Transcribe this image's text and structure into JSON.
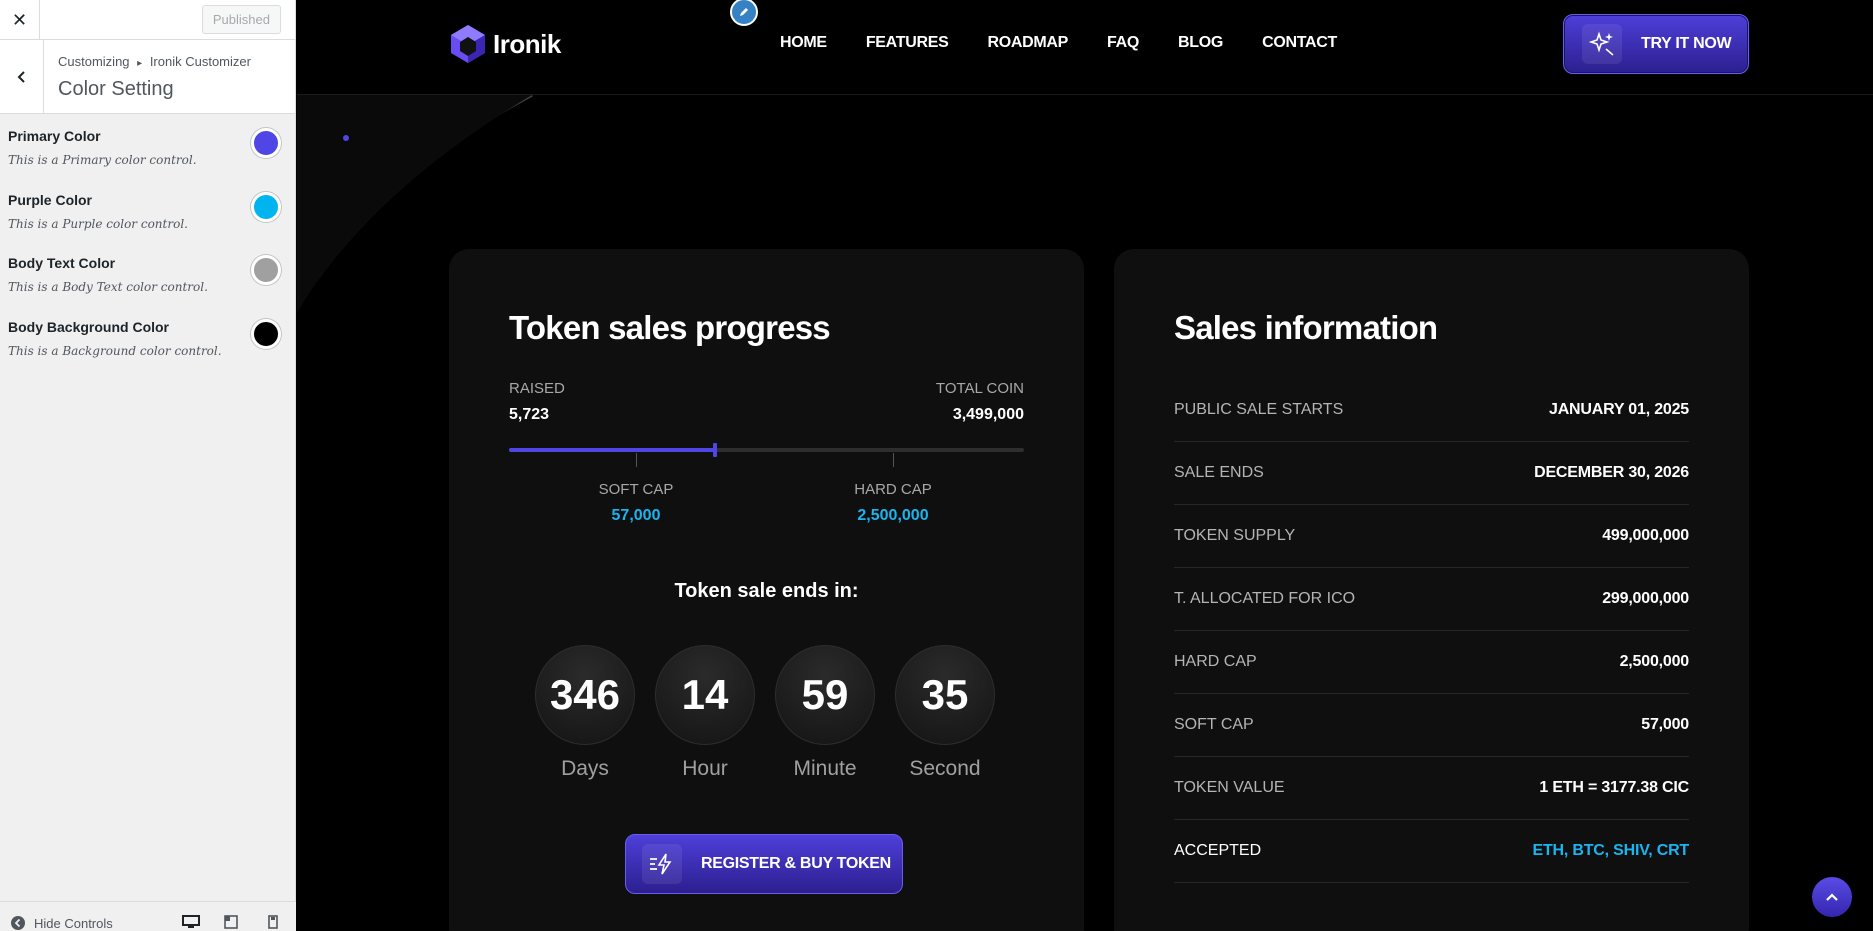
{
  "customizer": {
    "close_icon": "close-icon",
    "published_label": "Published",
    "breadcrumb_root": "Customizing",
    "breadcrumb_sep": "▸",
    "breadcrumb_parent": "Ironik Customizer",
    "section_title": "Color Setting",
    "controls": [
      {
        "label": "Primary Color",
        "description": "This is a Primary color control.",
        "color": "#4f46e5"
      },
      {
        "label": "Purple Color",
        "description": "This is a Purple color control.",
        "color": "#00b4f0"
      },
      {
        "label": "Body Text Color",
        "description": "This is a Body Text color control.",
        "color": "#a0a0a0"
      },
      {
        "label": "Body Background Color",
        "description": "This is a Background color control.",
        "color": "#000000"
      }
    ],
    "footer": {
      "hide_controls_label": "Hide Controls"
    }
  },
  "site": {
    "logo_text": "Ironik",
    "nav": [
      "HOME",
      "FEATURES",
      "ROADMAP",
      "FAQ",
      "BLOG",
      "CONTACT"
    ],
    "cta_label": "TRY IT NOW"
  },
  "progress": {
    "title": "Token sales progress",
    "raised_label": "RAISED",
    "raised_value": "5,723",
    "total_label": "TOTAL COIN",
    "total_value": "3,499,000",
    "fill_fraction": 0.4,
    "soft_cap_label": "SOFT CAP",
    "soft_cap_value": "57,000",
    "hard_cap_label": "HARD CAP",
    "hard_cap_value": "2,500,000",
    "ends_label": "Token sale ends in:",
    "countdown": [
      {
        "value": "346",
        "unit": "Days"
      },
      {
        "value": "14",
        "unit": "Hour"
      },
      {
        "value": "59",
        "unit": "Minute"
      },
      {
        "value": "35",
        "unit": "Second"
      }
    ],
    "register_label": "REGISTER & BUY TOKEN"
  },
  "sales": {
    "title": "Sales information",
    "rows": [
      {
        "key": "PUBLIC SALE STARTS",
        "value": "JANUARY 01, 2025"
      },
      {
        "key": "SALE ENDS",
        "value": "DECEMBER 30, 2026"
      },
      {
        "key": "TOKEN SUPPLY",
        "value": "499,000,000"
      },
      {
        "key": "T. ALLOCATED FOR ICO",
        "value": "299,000,000"
      },
      {
        "key": "HARD CAP",
        "value": "2,500,000"
      },
      {
        "key": "SOFT CAP",
        "value": "57,000"
      },
      {
        "key": "TOKEN VALUE",
        "value": "1 ETH = 3177.38 CIC"
      },
      {
        "key": "ACCEPTED",
        "value": "ETH, BTC, SHIV, CRT"
      }
    ]
  },
  "colors": {
    "accent": "#4f46e5",
    "accent_light": "#1ab5f0",
    "card_bg": "#0f0f10"
  }
}
